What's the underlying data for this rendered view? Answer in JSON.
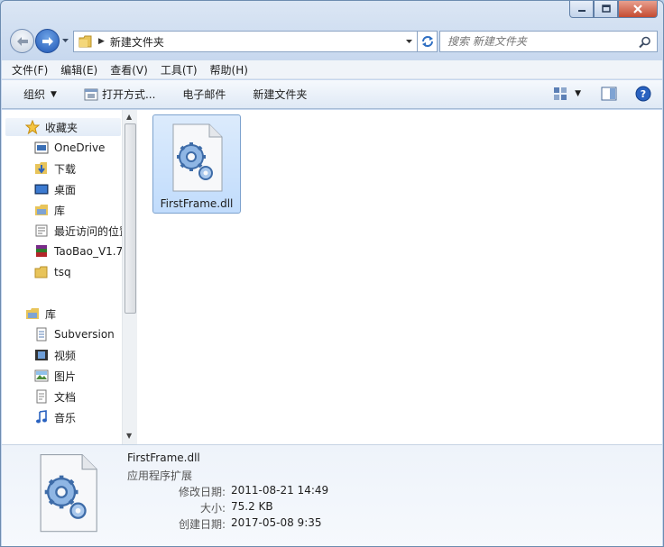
{
  "window": {
    "minimize_icon": "minimize-icon",
    "maximize_icon": "maximize-icon",
    "close_icon": "close-icon"
  },
  "address": {
    "path": "新建文件夹",
    "search_placeholder": "搜索 新建文件夹"
  },
  "menu": {
    "file": "文件(F)",
    "edit": "编辑(E)",
    "view": "查看(V)",
    "tools": "工具(T)",
    "help": "帮助(H)"
  },
  "toolbar": {
    "organize": "组织",
    "open_with": "打开方式...",
    "email": "电子邮件",
    "new_folder": "新建文件夹"
  },
  "sidebar": {
    "favorites": "收藏夹",
    "items": [
      {
        "label": "OneDrive",
        "icon": "onedrive-icon"
      },
      {
        "label": "下载",
        "icon": "downloads-icon"
      },
      {
        "label": "桌面",
        "icon": "desktop-icon"
      },
      {
        "label": "库",
        "icon": "library-icon"
      },
      {
        "label": "最近访问的位置",
        "icon": "recent-places-icon"
      },
      {
        "label": "TaoBao_V1.7",
        "icon": "winrar-icon"
      },
      {
        "label": "tsq",
        "icon": "folder-icon"
      }
    ],
    "libraries": "库",
    "lib_items": [
      {
        "label": "Subversion",
        "icon": "subversion-icon"
      },
      {
        "label": "视频",
        "icon": "video-icon"
      },
      {
        "label": "图片",
        "icon": "pictures-icon"
      },
      {
        "label": "文档",
        "icon": "documents-icon"
      },
      {
        "label": "音乐",
        "icon": "music-icon"
      }
    ]
  },
  "files": [
    {
      "name": "FirstFrame.dll",
      "icon": "dll-gear-icon",
      "selected": true
    }
  ],
  "details": {
    "name": "FirstFrame.dll",
    "type": "应用程序扩展",
    "modified_label": "修改日期:",
    "modified": "2011-08-21 14:49",
    "size_label": "大小:",
    "size": "75.2 KB",
    "created_label": "创建日期:",
    "created": "2017-05-08 9:35"
  },
  "colors": {
    "selection": "#cce4fc",
    "selection_border": "#7da2ce",
    "frame": "#c6d7ee"
  }
}
